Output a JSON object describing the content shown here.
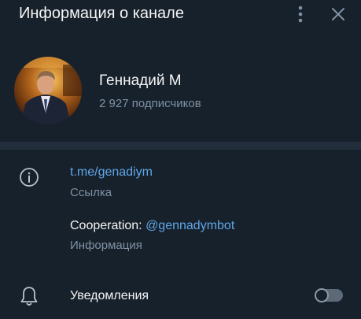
{
  "header": {
    "title": "Информация о канале",
    "more_icon": "kebab-menu-icon",
    "close_icon": "close-icon"
  },
  "profile": {
    "name": "Геннадий М",
    "subscribers": "2 927 подписчиков"
  },
  "info": {
    "link_value": "t.me/genadiym",
    "link_caption": "Ссылка",
    "description_prefix": "Cooperation: ",
    "description_link": "@gennadymbot",
    "description_caption": "Информация"
  },
  "notifications": {
    "label": "Уведомления",
    "enabled": false
  },
  "colors": {
    "background": "#17212b",
    "separator": "#232e3c",
    "link": "#5fa7e8",
    "muted_text": "#7f91a4"
  }
}
